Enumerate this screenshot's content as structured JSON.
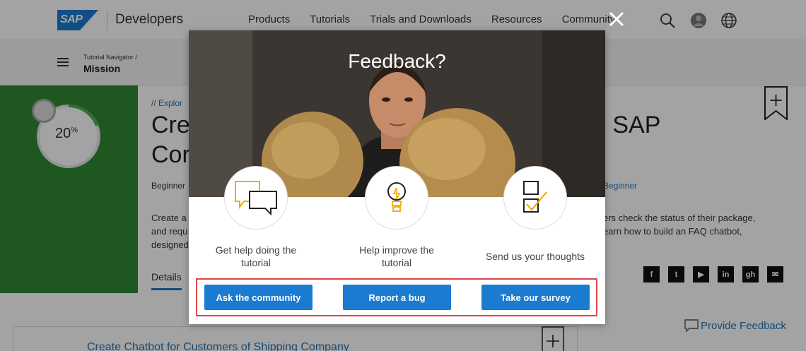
{
  "header": {
    "brand_logo": "SAP",
    "brand_name": "Developers",
    "nav": [
      "Products",
      "Tutorials",
      "Trials and Downloads",
      "Resources",
      "Community"
    ],
    "icons": [
      "search-icon",
      "avatar",
      "globe-icon"
    ]
  },
  "subbar": {
    "breadcrumb_small": "Tutorial Navigator /",
    "breadcrumb_main": "Mission"
  },
  "mission": {
    "progress_pct": 20,
    "progress_label": "20",
    "progress_unit": "%",
    "explore": "// Explor",
    "title_line1": "Cre",
    "title_line2": "Cor",
    "title_right": "n SAP",
    "level_left": "Beginner",
    "level_right": "Beginner",
    "desc_left_1": "Create a",
    "desc_left_2": "and requ",
    "desc_left_3": "designed",
    "desc_right_1": "ers check the status of their package,",
    "desc_right_2": "earn how to build an FAQ chatbot,",
    "tab_details": "Details"
  },
  "social_icons": [
    "f",
    "t",
    "▶",
    "in",
    "gh",
    "✉"
  ],
  "card": {
    "title": "Create Chatbot for Customers of Shipping Company",
    "provide_feedback": "Provide Feedback"
  },
  "modal": {
    "title": "Feedback?",
    "options": [
      {
        "icon": "chat-bubbles-icon",
        "caption_line1": "Get help doing the",
        "caption_line2": "tutorial",
        "button": "Ask the community"
      },
      {
        "icon": "lightbulb-icon",
        "caption_line1": "Help improve the",
        "caption_line2": "tutorial",
        "button": "Report a bug"
      },
      {
        "icon": "checklist-icon",
        "caption_line1": "Send us your thoughts",
        "button": "Take our survey"
      }
    ],
    "accent_color": "#f0ab00",
    "button_color": "#1a7bd1",
    "highlight_color": "#e34545"
  }
}
